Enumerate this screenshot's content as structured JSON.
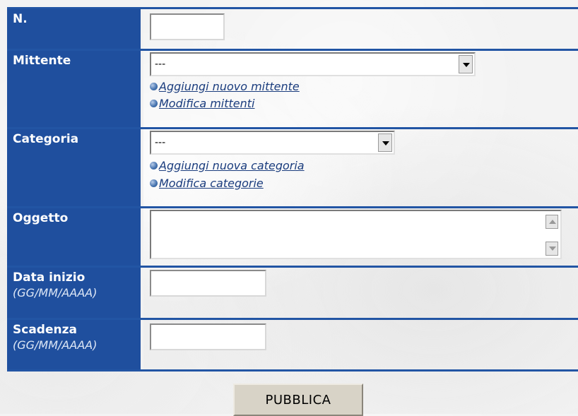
{
  "form": {
    "numero": {
      "label": "N.",
      "value": ""
    },
    "mittente": {
      "label": "Mittente",
      "selected": "---",
      "links": [
        "Aggiungi nuovo mittente",
        "Modifica mittenti"
      ]
    },
    "categoria": {
      "label": "Categoria",
      "selected": "---",
      "links": [
        "Aggiungi nuova categoria",
        "Modifica categorie"
      ]
    },
    "oggetto": {
      "label": "Oggetto",
      "value": ""
    },
    "data_inizio": {
      "label": "Data inizio",
      "hint": "(GG/MM/AAAA)",
      "value": ""
    },
    "scadenza": {
      "label": "Scadenza",
      "hint": "(GG/MM/AAAA)",
      "value": ""
    }
  },
  "submit_label": "PUBBLICA",
  "colors": {
    "label_bg": "#1f4f9e",
    "row_border": "#2255a4",
    "link": "#1b3d7e",
    "button_bg": "#d8d3c7"
  },
  "icons": {
    "link_bullet": "bullet-icon",
    "dropdown_arrow": "chevron-down-icon"
  }
}
